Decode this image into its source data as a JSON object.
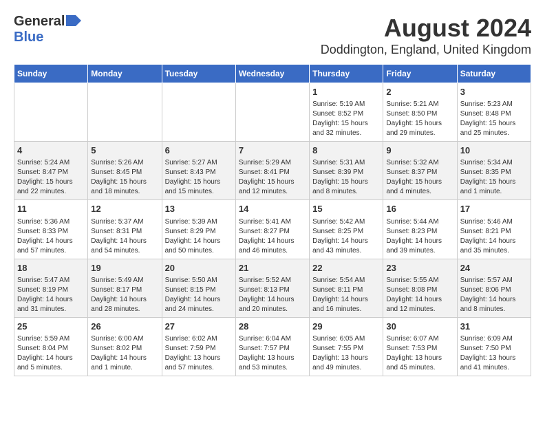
{
  "header": {
    "logo_general": "General",
    "logo_blue": "Blue",
    "title": "August 2024",
    "subtitle": "Doddington, England, United Kingdom"
  },
  "columns": [
    "Sunday",
    "Monday",
    "Tuesday",
    "Wednesday",
    "Thursday",
    "Friday",
    "Saturday"
  ],
  "rows": [
    [
      {
        "day": "",
        "info": ""
      },
      {
        "day": "",
        "info": ""
      },
      {
        "day": "",
        "info": ""
      },
      {
        "day": "",
        "info": ""
      },
      {
        "day": "1",
        "info": "Sunrise: 5:19 AM\nSunset: 8:52 PM\nDaylight: 15 hours\nand 32 minutes."
      },
      {
        "day": "2",
        "info": "Sunrise: 5:21 AM\nSunset: 8:50 PM\nDaylight: 15 hours\nand 29 minutes."
      },
      {
        "day": "3",
        "info": "Sunrise: 5:23 AM\nSunset: 8:48 PM\nDaylight: 15 hours\nand 25 minutes."
      }
    ],
    [
      {
        "day": "4",
        "info": "Sunrise: 5:24 AM\nSunset: 8:47 PM\nDaylight: 15 hours\nand 22 minutes."
      },
      {
        "day": "5",
        "info": "Sunrise: 5:26 AM\nSunset: 8:45 PM\nDaylight: 15 hours\nand 18 minutes."
      },
      {
        "day": "6",
        "info": "Sunrise: 5:27 AM\nSunset: 8:43 PM\nDaylight: 15 hours\nand 15 minutes."
      },
      {
        "day": "7",
        "info": "Sunrise: 5:29 AM\nSunset: 8:41 PM\nDaylight: 15 hours\nand 12 minutes."
      },
      {
        "day": "8",
        "info": "Sunrise: 5:31 AM\nSunset: 8:39 PM\nDaylight: 15 hours\nand 8 minutes."
      },
      {
        "day": "9",
        "info": "Sunrise: 5:32 AM\nSunset: 8:37 PM\nDaylight: 15 hours\nand 4 minutes."
      },
      {
        "day": "10",
        "info": "Sunrise: 5:34 AM\nSunset: 8:35 PM\nDaylight: 15 hours\nand 1 minute."
      }
    ],
    [
      {
        "day": "11",
        "info": "Sunrise: 5:36 AM\nSunset: 8:33 PM\nDaylight: 14 hours\nand 57 minutes."
      },
      {
        "day": "12",
        "info": "Sunrise: 5:37 AM\nSunset: 8:31 PM\nDaylight: 14 hours\nand 54 minutes."
      },
      {
        "day": "13",
        "info": "Sunrise: 5:39 AM\nSunset: 8:29 PM\nDaylight: 14 hours\nand 50 minutes."
      },
      {
        "day": "14",
        "info": "Sunrise: 5:41 AM\nSunset: 8:27 PM\nDaylight: 14 hours\nand 46 minutes."
      },
      {
        "day": "15",
        "info": "Sunrise: 5:42 AM\nSunset: 8:25 PM\nDaylight: 14 hours\nand 43 minutes."
      },
      {
        "day": "16",
        "info": "Sunrise: 5:44 AM\nSunset: 8:23 PM\nDaylight: 14 hours\nand 39 minutes."
      },
      {
        "day": "17",
        "info": "Sunrise: 5:46 AM\nSunset: 8:21 PM\nDaylight: 14 hours\nand 35 minutes."
      }
    ],
    [
      {
        "day": "18",
        "info": "Sunrise: 5:47 AM\nSunset: 8:19 PM\nDaylight: 14 hours\nand 31 minutes."
      },
      {
        "day": "19",
        "info": "Sunrise: 5:49 AM\nSunset: 8:17 PM\nDaylight: 14 hours\nand 28 minutes."
      },
      {
        "day": "20",
        "info": "Sunrise: 5:50 AM\nSunset: 8:15 PM\nDaylight: 14 hours\nand 24 minutes."
      },
      {
        "day": "21",
        "info": "Sunrise: 5:52 AM\nSunset: 8:13 PM\nDaylight: 14 hours\nand 20 minutes."
      },
      {
        "day": "22",
        "info": "Sunrise: 5:54 AM\nSunset: 8:11 PM\nDaylight: 14 hours\nand 16 minutes."
      },
      {
        "day": "23",
        "info": "Sunrise: 5:55 AM\nSunset: 8:08 PM\nDaylight: 14 hours\nand 12 minutes."
      },
      {
        "day": "24",
        "info": "Sunrise: 5:57 AM\nSunset: 8:06 PM\nDaylight: 14 hours\nand 8 minutes."
      }
    ],
    [
      {
        "day": "25",
        "info": "Sunrise: 5:59 AM\nSunset: 8:04 PM\nDaylight: 14 hours\nand 5 minutes."
      },
      {
        "day": "26",
        "info": "Sunrise: 6:00 AM\nSunset: 8:02 PM\nDaylight: 14 hours\nand 1 minute."
      },
      {
        "day": "27",
        "info": "Sunrise: 6:02 AM\nSunset: 7:59 PM\nDaylight: 13 hours\nand 57 minutes."
      },
      {
        "day": "28",
        "info": "Sunrise: 6:04 AM\nSunset: 7:57 PM\nDaylight: 13 hours\nand 53 minutes."
      },
      {
        "day": "29",
        "info": "Sunrise: 6:05 AM\nSunset: 7:55 PM\nDaylight: 13 hours\nand 49 minutes."
      },
      {
        "day": "30",
        "info": "Sunrise: 6:07 AM\nSunset: 7:53 PM\nDaylight: 13 hours\nand 45 minutes."
      },
      {
        "day": "31",
        "info": "Sunrise: 6:09 AM\nSunset: 7:50 PM\nDaylight: 13 hours\nand 41 minutes."
      }
    ]
  ]
}
